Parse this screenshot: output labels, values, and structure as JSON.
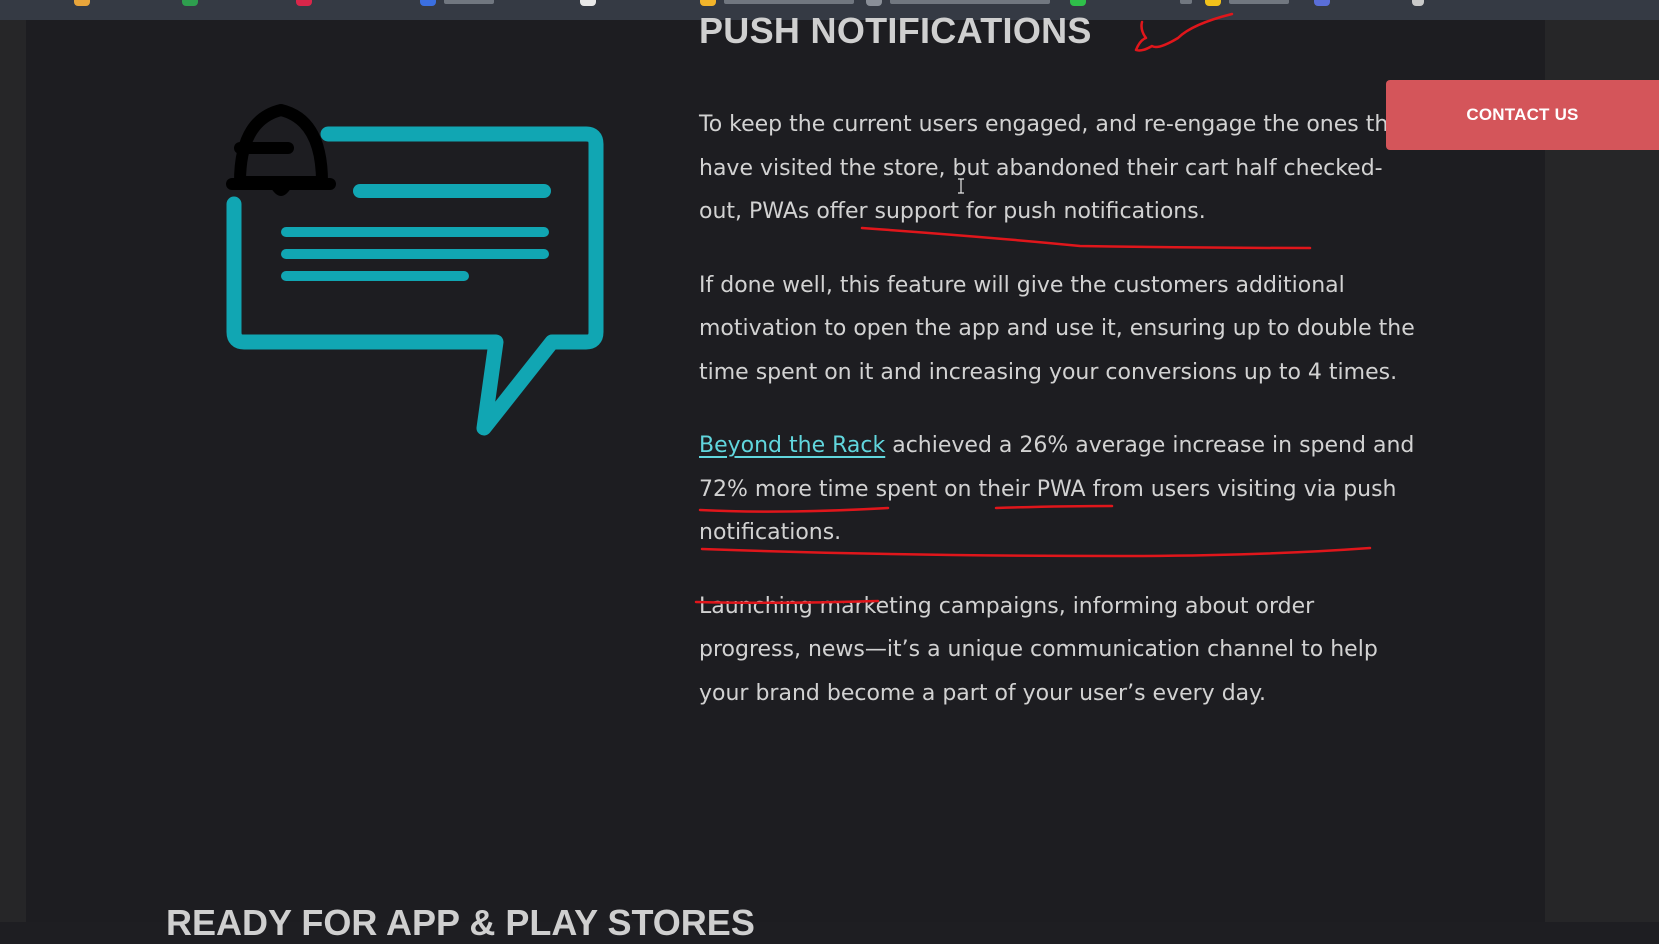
{
  "section": {
    "title": "PUSH NOTIFICATIONS",
    "paragraphs": {
      "p1": "To keep the current users engaged, and re-engage the ones that have visited the store, but abandoned their cart half checked-out, PWAs offer support for push notifications.",
      "p2": "If done well, this feature will give the customers additional motivation to open the app and use it, ensuring up to double the time spent on it and increasing your conversions up to 4 times.",
      "p3_link": "Beyond the Rack",
      "p3_rest": " achieved a 26% average increase in spend and 72% more time spent on their PWA from users visiting via push notifications.",
      "p4": "Launching marketing campaigns, informing about order progress, news—it’s a unique communication channel to help your brand become a part of your user’s every day."
    },
    "next_title": "READY FOR APP & PLAY STORES"
  },
  "contact_button": {
    "label": "CONTACT US"
  },
  "colors": {
    "accent": "#11a6b3",
    "link": "#61d6dd",
    "contact": "#d4555a",
    "annotation": "#e0161b"
  },
  "icons": {
    "illustration": "bell-chat-bubble-icon"
  }
}
